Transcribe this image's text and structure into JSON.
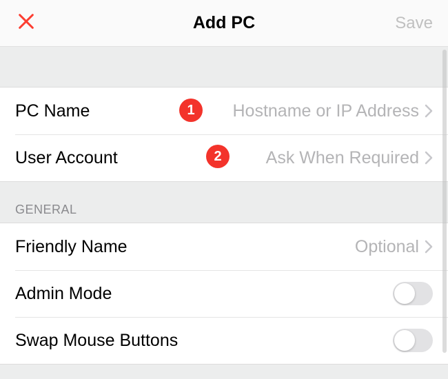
{
  "header": {
    "title": "Add PC",
    "save_label": "Save"
  },
  "rows": {
    "pc_name": {
      "label": "PC Name",
      "value": "Hostname or IP Address"
    },
    "user_account": {
      "label": "User Account",
      "value": "Ask When Required"
    },
    "friendly_name": {
      "label": "Friendly Name",
      "value": "Optional"
    },
    "admin_mode": {
      "label": "Admin Mode",
      "on": false
    },
    "swap_mouse": {
      "label": "Swap Mouse Buttons",
      "on": false
    }
  },
  "sections": {
    "general": "GENERAL"
  },
  "annotations": {
    "badge1": "1",
    "badge2": "2"
  },
  "colors": {
    "accent": "#fc3d30",
    "secondary_text": "#b4b4b6"
  }
}
